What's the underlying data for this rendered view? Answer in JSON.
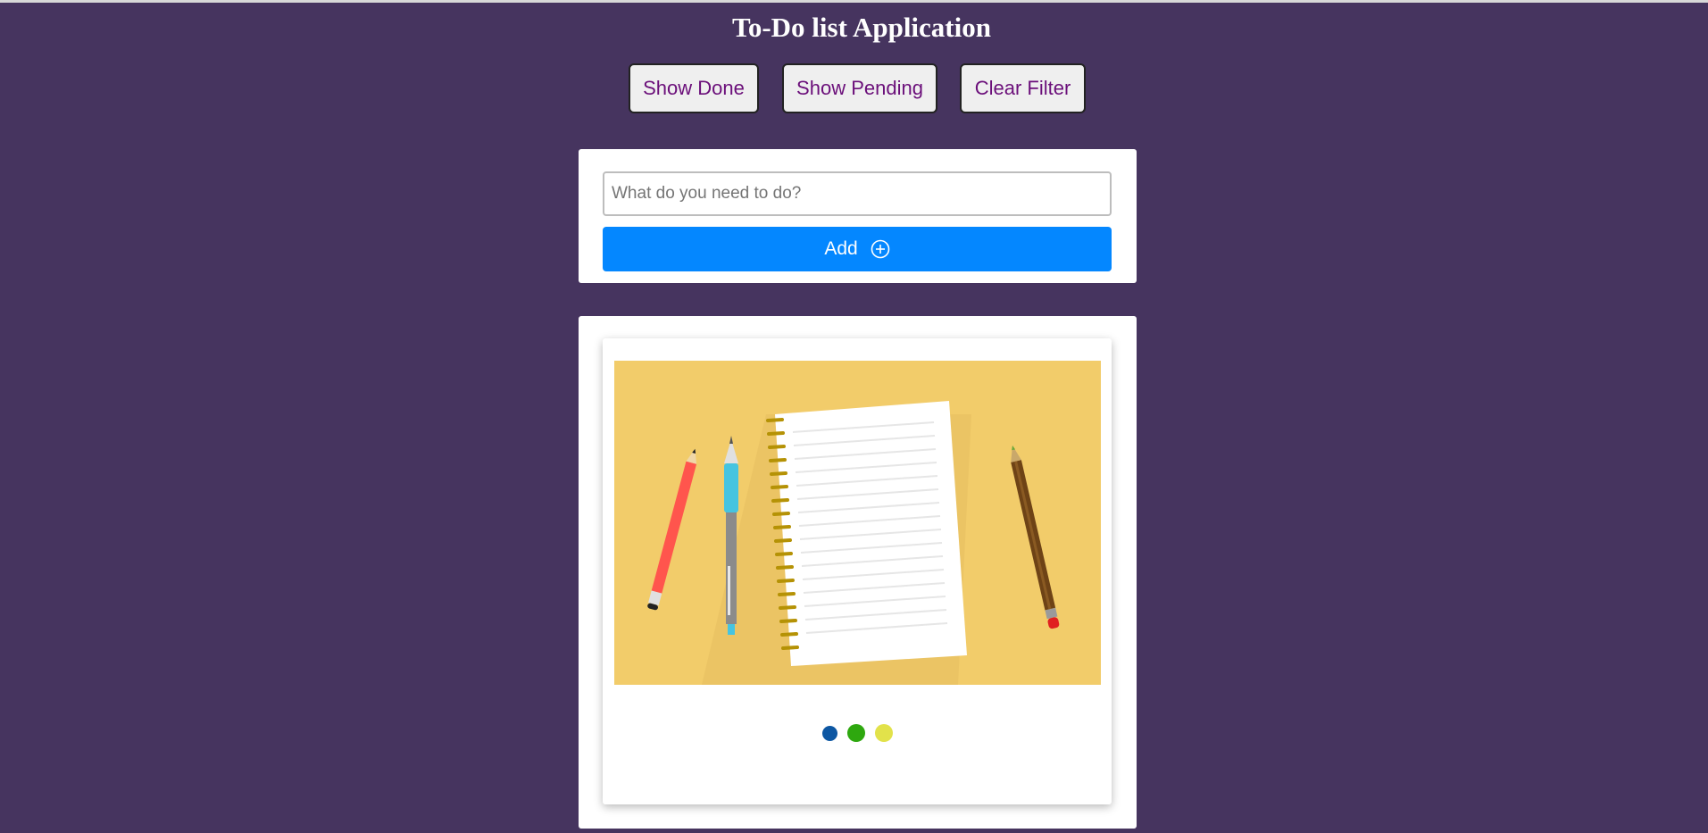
{
  "header": {
    "title": "To-Do list Application"
  },
  "filters": {
    "show_done": "Show Done",
    "show_pending": "Show Pending",
    "clear_filter": "Clear Filter"
  },
  "form": {
    "placeholder": "What do you need to do?",
    "value": "",
    "add_label": "Add",
    "add_icon": "plus-circle-icon"
  },
  "empty_state": {
    "illustration": "notebook-pencils-illustration",
    "dots": [
      {
        "color": "#0d57a3"
      },
      {
        "color": "#2ea80f"
      },
      {
        "color": "#e2e24a"
      }
    ]
  },
  "colors": {
    "background": "#46345f",
    "accent": "#0487ff",
    "filter_text": "#6b0f7a"
  }
}
